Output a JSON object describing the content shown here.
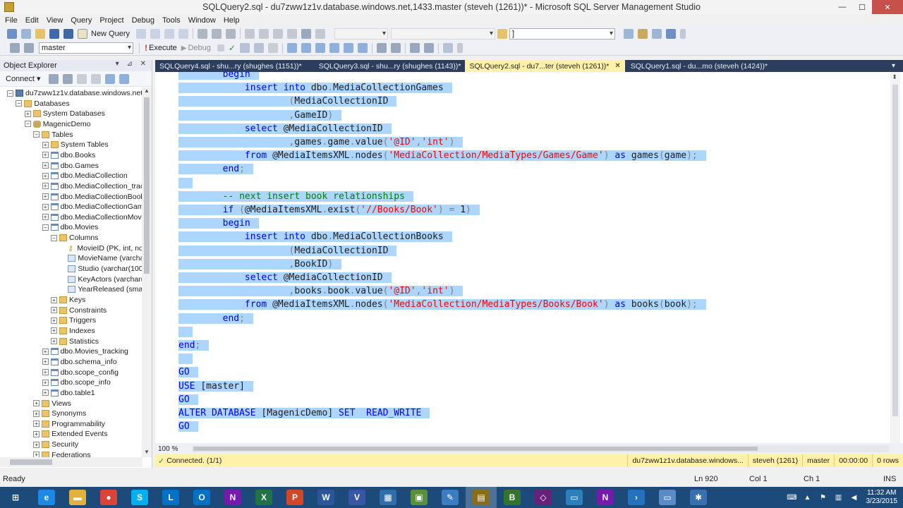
{
  "window": {
    "title": "SQLQuery2.sql - du7zww1z1v.database.windows.net,1433.master (steveh (1261))* - Microsoft SQL Server Management Studio",
    "minimize": "—",
    "maximize": "☐",
    "close": "✕"
  },
  "menu": [
    "File",
    "Edit",
    "View",
    "Query",
    "Project",
    "Debug",
    "Tools",
    "Window",
    "Help"
  ],
  "toolbar1": {
    "new_query": "New Query",
    "find_value": "]"
  },
  "toolbar2": {
    "database": "master",
    "execute": "Execute",
    "debug": "Debug"
  },
  "object_explorer": {
    "title": "Object Explorer",
    "pin": "▾ ⊿ ✕",
    "connect": "Connect ▾",
    "tree": [
      {
        "label": "du7zww1z1v.database.windows.net,14",
        "exp": "−",
        "icon": "server",
        "level": 0
      },
      {
        "label": "Databases",
        "exp": "−",
        "icon": "folder",
        "level": 1
      },
      {
        "label": "System Databases",
        "exp": "+",
        "icon": "folder",
        "level": 2
      },
      {
        "label": "MagenicDemo",
        "exp": "−",
        "icon": "db",
        "level": 2
      },
      {
        "label": "Tables",
        "exp": "−",
        "icon": "folder",
        "level": 3
      },
      {
        "label": "System Tables",
        "exp": "+",
        "icon": "folder",
        "level": 4
      },
      {
        "label": "dbo.Books",
        "exp": "+",
        "icon": "table",
        "level": 4
      },
      {
        "label": "dbo.Games",
        "exp": "+",
        "icon": "table",
        "level": 4
      },
      {
        "label": "dbo.MediaCollection",
        "exp": "+",
        "icon": "table",
        "level": 4
      },
      {
        "label": "dbo.MediaCollection_track",
        "exp": "+",
        "icon": "table",
        "level": 4
      },
      {
        "label": "dbo.MediaCollectionBook",
        "exp": "+",
        "icon": "table",
        "level": 4
      },
      {
        "label": "dbo.MediaCollectionGam",
        "exp": "+",
        "icon": "table",
        "level": 4
      },
      {
        "label": "dbo.MediaCollectionMovi",
        "exp": "+",
        "icon": "table",
        "level": 4
      },
      {
        "label": "dbo.Movies",
        "exp": "−",
        "icon": "table",
        "level": 4
      },
      {
        "label": "Columns",
        "exp": "−",
        "icon": "folder",
        "level": 5
      },
      {
        "label": "MovieID (PK, int, not",
        "exp": "",
        "icon": "key",
        "level": 6
      },
      {
        "label": "MovieName (varcha",
        "exp": "",
        "icon": "col",
        "level": 6
      },
      {
        "label": "Studio (varchar(100)",
        "exp": "",
        "icon": "col",
        "level": 6
      },
      {
        "label": "KeyActors (varchar(r",
        "exp": "",
        "icon": "col",
        "level": 6
      },
      {
        "label": "YearReleased (small",
        "exp": "",
        "icon": "col",
        "level": 6
      },
      {
        "label": "Keys",
        "exp": "+",
        "icon": "folder",
        "level": 5
      },
      {
        "label": "Constraints",
        "exp": "+",
        "icon": "folder",
        "level": 5
      },
      {
        "label": "Triggers",
        "exp": "+",
        "icon": "folder",
        "level": 5
      },
      {
        "label": "Indexes",
        "exp": "+",
        "icon": "folder",
        "level": 5
      },
      {
        "label": "Statistics",
        "exp": "+",
        "icon": "folder",
        "level": 5
      },
      {
        "label": "dbo.Movies_tracking",
        "exp": "+",
        "icon": "table",
        "level": 4
      },
      {
        "label": "dbo.schema_info",
        "exp": "+",
        "icon": "table",
        "level": 4
      },
      {
        "label": "dbo.scope_config",
        "exp": "+",
        "icon": "table",
        "level": 4
      },
      {
        "label": "dbo.scope_info",
        "exp": "+",
        "icon": "table",
        "level": 4
      },
      {
        "label": "dbo.table1",
        "exp": "+",
        "icon": "table",
        "level": 4
      },
      {
        "label": "Views",
        "exp": "+",
        "icon": "folder",
        "level": 3
      },
      {
        "label": "Synonyms",
        "exp": "+",
        "icon": "folder",
        "level": 3
      },
      {
        "label": "Programmability",
        "exp": "+",
        "icon": "folder",
        "level": 3
      },
      {
        "label": "Extended Events",
        "exp": "+",
        "icon": "folder",
        "level": 3
      },
      {
        "label": "Security",
        "exp": "+",
        "icon": "folder",
        "level": 3
      },
      {
        "label": "Federations",
        "exp": "+",
        "icon": "folder",
        "level": 3
      }
    ]
  },
  "tabs": [
    {
      "label": "SQLQuery4.sql - shu...ry (shughes (1151))*",
      "active": false
    },
    {
      "label": "SQLQuery3.sql - shu...ry (shughes (1143))*",
      "active": false
    },
    {
      "label": "SQLQuery2.sql - du7...ter (steveh (1261))*",
      "active": true
    },
    {
      "label": "SQLQuery1.sql - du...mo (steveh (1424))*",
      "active": false
    }
  ],
  "code_lines": [
    [
      [
        "kw",
        "        begin"
      ]
    ],
    [
      [
        "kw",
        "            insert into "
      ],
      [
        "obj",
        "dbo"
      ],
      [
        "gr",
        "."
      ],
      [
        "obj",
        "MediaCollectionGames"
      ]
    ],
    [
      [
        "gr",
        "                    ("
      ],
      [
        "obj",
        "MediaCollectionID"
      ]
    ],
    [
      [
        "gr",
        "                    ,"
      ],
      [
        "obj",
        "GameID"
      ],
      [
        "gr",
        ")"
      ]
    ],
    [
      [
        "kw",
        "            select "
      ],
      [
        "obj",
        "@MediaCollectionID"
      ]
    ],
    [
      [
        "gr",
        "                    ,"
      ],
      [
        "obj",
        "games"
      ],
      [
        "gr",
        "."
      ],
      [
        "obj",
        "game"
      ],
      [
        "gr",
        "."
      ],
      [
        "fn",
        "value"
      ],
      [
        "gr",
        "("
      ],
      [
        "str",
        "'@ID'"
      ],
      [
        "gr",
        ","
      ],
      [
        "str",
        "'int'"
      ],
      [
        "gr",
        ")"
      ]
    ],
    [
      [
        "kw",
        "            from "
      ],
      [
        "obj",
        "@MediaItemsXML"
      ],
      [
        "gr",
        "."
      ],
      [
        "fn",
        "nodes"
      ],
      [
        "gr",
        "("
      ],
      [
        "str",
        "'MediaCollection/MediaTypes/Games/Game'"
      ],
      [
        "gr",
        ") "
      ],
      [
        "kw",
        "as "
      ],
      [
        "obj",
        "games"
      ],
      [
        "gr",
        "("
      ],
      [
        "obj",
        "game"
      ],
      [
        "gr",
        ");"
      ]
    ],
    [
      [
        "kw",
        "        end"
      ],
      [
        "gr",
        ";"
      ]
    ],
    [
      [
        "gr",
        " "
      ]
    ],
    [
      [
        "cm",
        "        -- next insert book relationships"
      ]
    ],
    [
      [
        "kw",
        "        if "
      ],
      [
        "gr",
        "("
      ],
      [
        "obj",
        "@MediaItemsXML"
      ],
      [
        "gr",
        "."
      ],
      [
        "fn",
        "exist"
      ],
      [
        "gr",
        "("
      ],
      [
        "str",
        "'//Books/Book'"
      ],
      [
        "gr",
        ") = "
      ],
      [
        "obj",
        "1"
      ],
      [
        "gr",
        ")"
      ]
    ],
    [
      [
        "kw",
        "        begin"
      ]
    ],
    [
      [
        "kw",
        "            insert into "
      ],
      [
        "obj",
        "dbo"
      ],
      [
        "gr",
        "."
      ],
      [
        "obj",
        "MediaCollectionBooks"
      ]
    ],
    [
      [
        "gr",
        "                    ("
      ],
      [
        "obj",
        "MediaCollectionID"
      ]
    ],
    [
      [
        "gr",
        "                    ,"
      ],
      [
        "obj",
        "BookID"
      ],
      [
        "gr",
        ")"
      ]
    ],
    [
      [
        "kw",
        "            select "
      ],
      [
        "obj",
        "@MediaCollectionID"
      ]
    ],
    [
      [
        "gr",
        "                    ,"
      ],
      [
        "obj",
        "books"
      ],
      [
        "gr",
        "."
      ],
      [
        "obj",
        "book"
      ],
      [
        "gr",
        "."
      ],
      [
        "fn",
        "value"
      ],
      [
        "gr",
        "("
      ],
      [
        "str",
        "'@ID'"
      ],
      [
        "gr",
        ","
      ],
      [
        "str",
        "'int'"
      ],
      [
        "gr",
        ")"
      ]
    ],
    [
      [
        "kw",
        "            from "
      ],
      [
        "obj",
        "@MediaItemsXML"
      ],
      [
        "gr",
        "."
      ],
      [
        "fn",
        "nodes"
      ],
      [
        "gr",
        "("
      ],
      [
        "str",
        "'MediaCollection/MediaTypes/Books/Book'"
      ],
      [
        "gr",
        ") "
      ],
      [
        "kw",
        "as "
      ],
      [
        "obj",
        "books"
      ],
      [
        "gr",
        "("
      ],
      [
        "obj",
        "book"
      ],
      [
        "gr",
        ");"
      ]
    ],
    [
      [
        "kw",
        "        end"
      ],
      [
        "gr",
        ";"
      ]
    ],
    [
      [
        "gr",
        " "
      ]
    ],
    [
      [
        "kw",
        "end"
      ],
      [
        "gr",
        ";"
      ]
    ],
    [
      [
        "gr",
        " "
      ]
    ],
    [
      [
        "kw",
        "GO"
      ]
    ],
    [
      [
        "kw",
        "USE "
      ],
      [
        "obj",
        "[master]"
      ]
    ],
    [
      [
        "kw",
        "GO"
      ]
    ],
    [
      [
        "kw",
        "ALTER DATABASE "
      ],
      [
        "obj",
        "[MagenicDemo] "
      ],
      [
        "kw",
        "SET  READ_WRITE"
      ]
    ],
    [
      [
        "kw",
        "GO"
      ]
    ]
  ],
  "zoom": "100 %",
  "query_status": {
    "connected": "Connected. (1/1)",
    "server": "du7zww1z1v.database.windows...",
    "user": "steveh (1261)",
    "database": "master",
    "time": "00:00:00",
    "rows": "0 rows"
  },
  "statusbar": {
    "ready": "Ready",
    "ln": "Ln 920",
    "col": "Col 1",
    "ch": "Ch 1",
    "mode": "INS"
  },
  "taskbar": {
    "apps": [
      {
        "name": "start",
        "glyph": "⊞",
        "color": "#1c4a7a"
      },
      {
        "name": "ie",
        "glyph": "e",
        "color": "#1e88e5"
      },
      {
        "name": "explorer",
        "glyph": "▬",
        "color": "#e3b23c"
      },
      {
        "name": "chrome",
        "glyph": "●",
        "color": "#db4437"
      },
      {
        "name": "skype",
        "glyph": "S",
        "color": "#00aff0"
      },
      {
        "name": "lync",
        "glyph": "L",
        "color": "#0072c6"
      },
      {
        "name": "outlook",
        "glyph": "O",
        "color": "#0072c6"
      },
      {
        "name": "onenote",
        "glyph": "N",
        "color": "#7719aa"
      },
      {
        "name": "excel",
        "glyph": "X",
        "color": "#217346"
      },
      {
        "name": "powerpoint",
        "glyph": "P",
        "color": "#d24726"
      },
      {
        "name": "word",
        "glyph": "W",
        "color": "#2b579a"
      },
      {
        "name": "visio",
        "glyph": "V",
        "color": "#3955a3"
      },
      {
        "name": "app-blue",
        "glyph": "▦",
        "color": "#2f6ea8"
      },
      {
        "name": "app-green",
        "glyph": "▣",
        "color": "#5a8f3c"
      },
      {
        "name": "paint",
        "glyph": "✎",
        "color": "#3c7cc0"
      },
      {
        "name": "ssms",
        "glyph": "▤",
        "color": "#8a6d1a"
      },
      {
        "name": "project",
        "glyph": "B",
        "color": "#31752f"
      },
      {
        "name": "visual-studio",
        "glyph": "◇",
        "color": "#68217a"
      },
      {
        "name": "app-monitor",
        "glyph": "▭",
        "color": "#2c7fb8"
      },
      {
        "name": "onenote2",
        "glyph": "N",
        "color": "#7719aa"
      },
      {
        "name": "powershell",
        "glyph": "›",
        "color": "#2671be"
      },
      {
        "name": "app-window",
        "glyph": "▭",
        "color": "#5b8bc4"
      },
      {
        "name": "settings",
        "glyph": "✱",
        "color": "#3a6fb0"
      }
    ],
    "time": "11:32 AM",
    "date": "3/23/2015"
  }
}
